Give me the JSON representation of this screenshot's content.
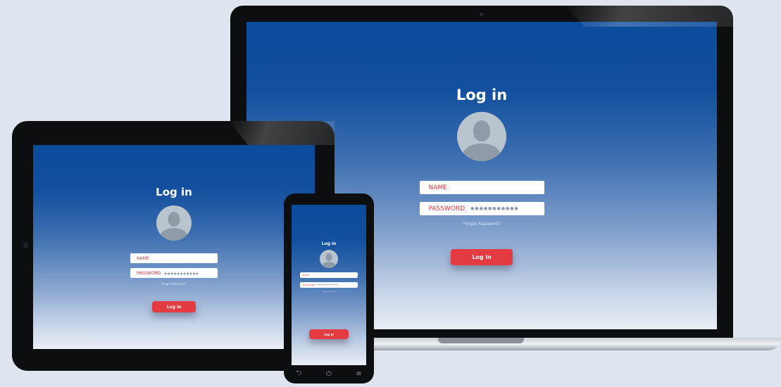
{
  "laptop": {
    "title": "Log in",
    "name_label": "NAME",
    "password_label": "PASSWORD",
    "password_mask": "●●●●●●●●●●●",
    "forgot": "Forgot Password?",
    "button": "Log in"
  },
  "tablet": {
    "title": "Log in",
    "name_label": "NAME",
    "password_label": "PASSWORD",
    "password_mask": "●●●●●●●●●●●",
    "forgot": "Forgot Password?",
    "button": "Log in"
  },
  "phone": {
    "title": "Log in",
    "name_label": "NAME",
    "password_label": "PASSWORD",
    "password_mask": "●●●●●●●●●●●",
    "forgot": "Forgot Password?",
    "button": "Log in",
    "nav": {
      "back": "⮌",
      "power": "⏻",
      "menu": "≡"
    }
  },
  "colors": {
    "button": "#e33b41",
    "field_text": "#e23a3f",
    "screen_top": "#0b4b9b",
    "background": "#dfe5ee"
  }
}
